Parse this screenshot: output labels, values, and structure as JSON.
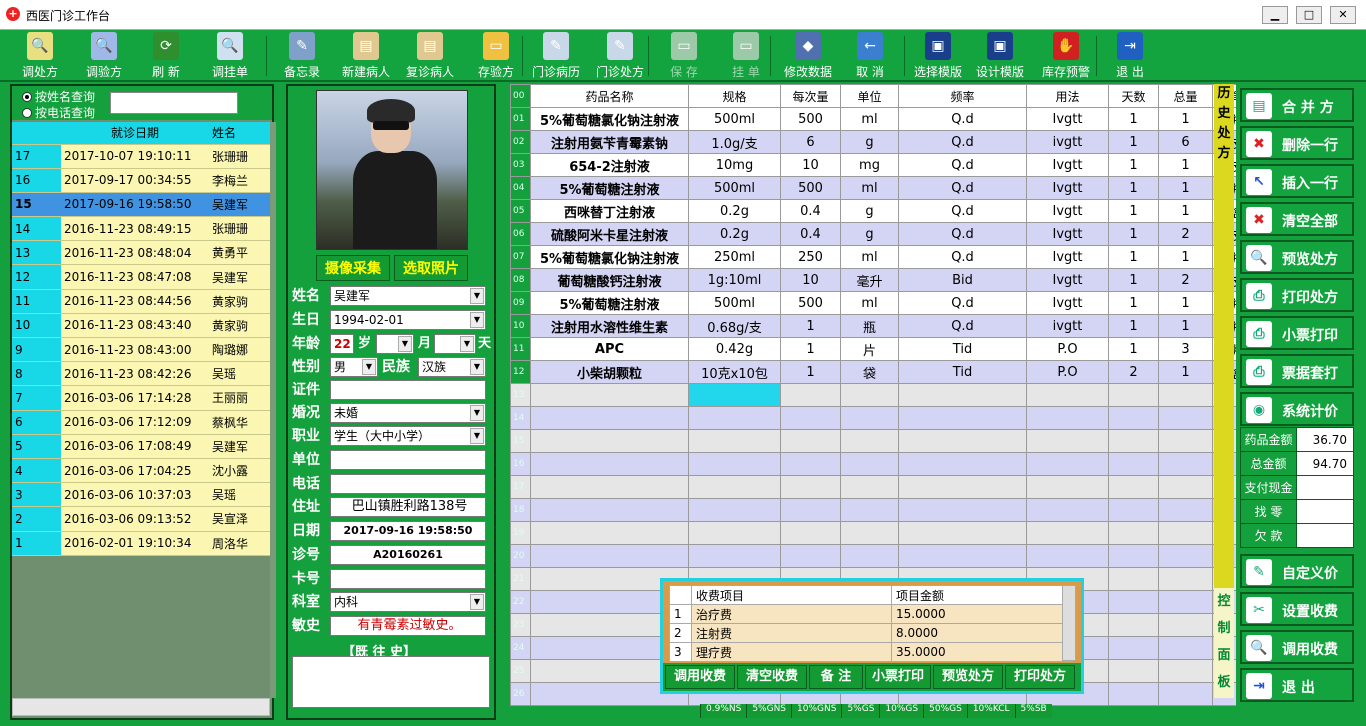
{
  "window": {
    "title": "西医门诊工作台"
  },
  "toolbar": [
    {
      "label": "调处方",
      "icon": "magnifier-icon",
      "enabled": true
    },
    {
      "label": "调验方",
      "icon": "magnifier-doc-icon",
      "enabled": true
    },
    {
      "label": "刷 新",
      "icon": "refresh-icon",
      "enabled": true
    },
    {
      "label": "调挂单",
      "icon": "magnifier-list-icon",
      "enabled": true
    },
    {
      "label": "备忘录",
      "icon": "memo-icon",
      "enabled": true
    },
    {
      "label": "新建病人",
      "icon": "new-patient-icon",
      "enabled": true
    },
    {
      "label": "复诊病人",
      "icon": "revisit-icon",
      "enabled": true
    },
    {
      "label": "存验方",
      "icon": "save-folder-icon",
      "enabled": true
    },
    {
      "label": "门诊病历",
      "icon": "record-icon",
      "enabled": true
    },
    {
      "label": "门诊处方",
      "icon": "prescription-icon",
      "enabled": true
    },
    {
      "label": "保 存",
      "icon": "save-icon",
      "enabled": false
    },
    {
      "label": "挂 单",
      "icon": "pending-icon",
      "enabled": false
    },
    {
      "label": "修改数据",
      "icon": "eraser-icon",
      "enabled": true
    },
    {
      "label": "取 消",
      "icon": "cancel-arrow-icon",
      "enabled": true
    },
    {
      "label": "选择模版",
      "icon": "template-icon",
      "enabled": true
    },
    {
      "label": "设计模版",
      "icon": "design-icon",
      "enabled": true
    },
    {
      "label": "库存预警",
      "icon": "stop-icon",
      "enabled": true
    },
    {
      "label": "退 出",
      "icon": "exit-door-icon",
      "enabled": true
    }
  ],
  "search": {
    "option1": "按姓名查询",
    "option2": "按电话查询",
    "selected": "option1",
    "value": ""
  },
  "visits": {
    "headers": [
      "",
      "就诊日期",
      "姓名"
    ],
    "selected_index": 2,
    "rows": [
      {
        "no": "17",
        "date": "2017-10-07 19:10:11",
        "name": "张珊珊"
      },
      {
        "no": "16",
        "date": "2017-09-17 00:34:55",
        "name": "李梅兰"
      },
      {
        "no": "15",
        "date": "2017-09-16 19:58:50",
        "name": "吴建军"
      },
      {
        "no": "14",
        "date": "2016-11-23 08:49:15",
        "name": "张珊珊"
      },
      {
        "no": "13",
        "date": "2016-11-23 08:48:04",
        "name": "黄勇平"
      },
      {
        "no": "12",
        "date": "2016-11-23 08:47:08",
        "name": "吴建军"
      },
      {
        "no": "11",
        "date": "2016-11-23 08:44:56",
        "name": "黄家驹"
      },
      {
        "no": "10",
        "date": "2016-11-23 08:43:40",
        "name": "黄家驹"
      },
      {
        "no": "9",
        "date": "2016-11-23 08:43:00",
        "name": "陶璐娜"
      },
      {
        "no": "8",
        "date": "2016-11-23 08:42:26",
        "name": "吴瑶"
      },
      {
        "no": "7",
        "date": "2016-03-06 17:14:28",
        "name": "王丽丽"
      },
      {
        "no": "6",
        "date": "2016-03-06 17:12:09",
        "name": "蔡枫华"
      },
      {
        "no": "5",
        "date": "2016-03-06 17:08:49",
        "name": "吴建军"
      },
      {
        "no": "4",
        "date": "2016-03-06 17:04:25",
        "name": "沈小露"
      },
      {
        "no": "3",
        "date": "2016-03-06 10:37:03",
        "name": "吴瑶"
      },
      {
        "no": "2",
        "date": "2016-03-06 09:13:52",
        "name": "吴宣泽"
      },
      {
        "no": "1",
        "date": "2016-02-01 19:10:34",
        "name": "周洛华"
      }
    ]
  },
  "patient": {
    "btn_capture": "摄像采集",
    "btn_photo": "选取照片",
    "labels": {
      "name": "姓名",
      "birth": "生日",
      "age": "年龄",
      "age_unit": "岁",
      "month": "月",
      "day": "天",
      "gender": "性别",
      "ethnic": "民族",
      "id": "证件",
      "marital": "婚况",
      "job": "职业",
      "unit": "单位",
      "phone": "电话",
      "address": "住址",
      "date": "日期",
      "visit_no": "诊号",
      "card": "卡号",
      "dept": "科室",
      "allergy": "敏史",
      "history": "【既 往 史】"
    },
    "name": "吴建军",
    "birth": "1994-02-01",
    "age": "22",
    "gender": "男",
    "ethnic": "汉族",
    "marital": "未婚",
    "job": "学生（大中小学）",
    "address": "巴山镇胜利路138号",
    "date": "2017-09-16 19:58:50",
    "visit_no": "A20160261",
    "dept": "内科",
    "allergy": "有青霉素过敏史。"
  },
  "prescription": {
    "headers": [
      "药品名称",
      "规格",
      "每次量",
      "单位",
      "频率",
      "用法",
      "天数",
      "总量",
      "单位"
    ],
    "row_numbers": [
      "00",
      "01",
      "02",
      "03",
      "04",
      "05",
      "06",
      "07",
      "08",
      "09",
      "10",
      "11",
      "12",
      "13",
      "14",
      "15",
      "16",
      "17",
      "18",
      "19",
      "20",
      "21",
      "22",
      "23",
      "24",
      "25",
      "26"
    ],
    "rows": [
      [
        "5%葡萄糖氯化钠注射液",
        "500ml",
        "500",
        "ml",
        "Q.d",
        "Ivgtt",
        "1",
        "1",
        "瓶"
      ],
      [
        "注射用氨苄青霉素钠",
        "1.0g/支",
        "6",
        "g",
        "Q.d",
        "ivgtt",
        "1",
        "6",
        "支"
      ],
      [
        "654-2注射液",
        "10mg",
        "10",
        "mg",
        "Q.d",
        "Ivgtt",
        "1",
        "1",
        "支"
      ],
      [
        "5%葡萄糖注射液",
        "500ml",
        "500",
        "ml",
        "Q.d",
        "Ivgtt",
        "1",
        "1",
        "瓶"
      ],
      [
        "西咪替丁注射液",
        "0.2g",
        "0.4",
        "g",
        "Q.d",
        "Ivgtt",
        "1",
        "1",
        "盒"
      ],
      [
        "硫酸阿米卡星注射液",
        "0.2g",
        "0.4",
        "g",
        "Q.d",
        "Ivgtt",
        "1",
        "2",
        "支"
      ],
      [
        "5%葡萄糖氯化钠注射液",
        "250ml",
        "250",
        "ml",
        "Q.d",
        "Ivgtt",
        "1",
        "1",
        "瓶"
      ],
      [
        "葡萄糖酸钙注射液",
        "1g:10ml",
        "10",
        "毫升",
        "Bid",
        "Ivgtt",
        "1",
        "2",
        "支"
      ],
      [
        "5%葡萄糖注射液",
        "500ml",
        "500",
        "ml",
        "Q.d",
        "Ivgtt",
        "1",
        "1",
        "瓶"
      ],
      [
        "注射用水溶性维生素",
        "0.68g/支",
        "1",
        "瓶",
        "Q.d",
        "ivgtt",
        "1",
        "1",
        "瓶"
      ],
      [
        "APC",
        "0.42g",
        "1",
        "片",
        "Tid",
        "P.O",
        "1",
        "3",
        "片"
      ],
      [
        "小柴胡颗粒",
        "10克x10包",
        "1",
        "袋",
        "Tid",
        "P.O",
        "2",
        "1",
        "盒"
      ]
    ]
  },
  "side_vertical": {
    "top": "历史处方",
    "bottom": "控制面板"
  },
  "fees": {
    "headers": [
      "收费项目",
      "项目金额"
    ],
    "rows": [
      {
        "i": "1",
        "item": "治疗费",
        "amount": "15.0000"
      },
      {
        "i": "2",
        "item": "注射费",
        "amount": "8.0000"
      },
      {
        "i": "3",
        "item": "理疗费",
        "amount": "35.0000"
      }
    ],
    "buttons": [
      "调用收费",
      "清空收费",
      "备 注",
      "小票打印",
      "预览处方",
      "打印处方"
    ]
  },
  "statusbar": [
    "0.9%NS",
    "5%GNS",
    "10%GNS",
    "5%GS",
    "10%GS",
    "50%GS",
    "10%KCL",
    "5%SB"
  ],
  "right": {
    "buttons": [
      {
        "label": "合 并 方",
        "icon": "merge-icon"
      },
      {
        "label": "删除一行",
        "icon": "delete-row-icon"
      },
      {
        "label": "插入一行",
        "icon": "insert-row-icon"
      },
      {
        "label": "清空全部",
        "icon": "clear-all-icon"
      },
      {
        "label": "预览处方",
        "icon": "preview-icon"
      },
      {
        "label": "打印处方",
        "icon": "print-icon"
      },
      {
        "label": "小票打印",
        "icon": "receipt-print-icon"
      },
      {
        "label": "票据套打",
        "icon": "bill-print-icon"
      },
      {
        "label": "系统计价",
        "icon": "pricing-icon"
      }
    ],
    "amounts": [
      {
        "k": "药品金额",
        "v": "36.70"
      },
      {
        "k": "总金额",
        "v": "94.70"
      },
      {
        "k": "支付现金",
        "v": ""
      },
      {
        "k": "找 零",
        "v": ""
      },
      {
        "k": "欠 款",
        "v": ""
      }
    ],
    "buttons2": [
      {
        "label": "自定义价",
        "icon": "custom-price-icon"
      },
      {
        "label": "设置收费",
        "icon": "settings-tools-icon"
      },
      {
        "label": "调用收费",
        "icon": "load-fee-icon"
      },
      {
        "label": "退 出",
        "icon": "exit-icon"
      }
    ]
  },
  "colors": {
    "panel": "#14a03c",
    "select": "#3f93e0",
    "header_cyan": "#18d8e8",
    "row_yellow": "#fbf7b2",
    "grid_alt": "#d4d4f5"
  }
}
